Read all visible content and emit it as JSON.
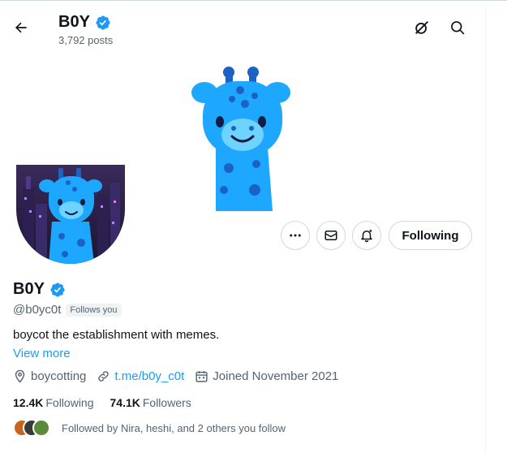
{
  "header": {
    "title": "B0Y",
    "posts": "3,792 posts",
    "icons": [
      "back-arrow-icon",
      "grok-icon",
      "search-icon"
    ]
  },
  "profile": {
    "name": "B0Y",
    "handle": "@b0yc0t",
    "follows_you": "Follows you",
    "bio": "boycot the establishment with memes.",
    "view_more": "View more",
    "location": "boycotting",
    "link": "t.me/b0y_c0t",
    "joined": "Joined November 2021",
    "following_count": "12.4K",
    "following_label": "Following",
    "followers_count": "74.1K",
    "followers_label": "Followers",
    "followed_by": "Followed by Nira, heshi, and 2 others you follow"
  },
  "actions": {
    "following_button": "Following",
    "icons": [
      "more-icon",
      "message-icon",
      "notifications-icon"
    ]
  },
  "colors": {
    "accent": "#1d9bf0",
    "verified": "#1d9bf0",
    "giraffe": "#1ea7ff",
    "spots": "#1b62c4"
  }
}
